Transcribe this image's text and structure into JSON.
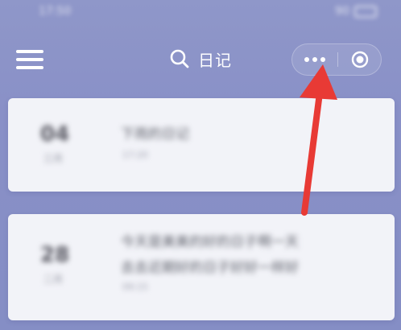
{
  "status_bar": {
    "time": "17:50",
    "right": "90"
  },
  "header": {
    "title": "日记",
    "menu_icon": "hamburger-menu-icon",
    "search_icon": "search-icon",
    "more_icon": "more-horizontal-icon",
    "close_icon": "target-circle-icon"
  },
  "diary_entries": [
    {
      "day": "04",
      "month": "三月",
      "lines": [
        "下雨的日记"
      ],
      "meta": "17:20"
    },
    {
      "day": "28",
      "month": "二月",
      "lines": [
        "今天是美美的好的日子啊一天",
        "去去近期好的日子好好一样好"
      ],
      "meta": "09:15"
    }
  ],
  "annotation": {
    "color": "#e83a35",
    "target": "more-button"
  },
  "colors": {
    "background": "#8a92c8",
    "card": "#f2f3f8",
    "header_text": "#ffffff"
  }
}
